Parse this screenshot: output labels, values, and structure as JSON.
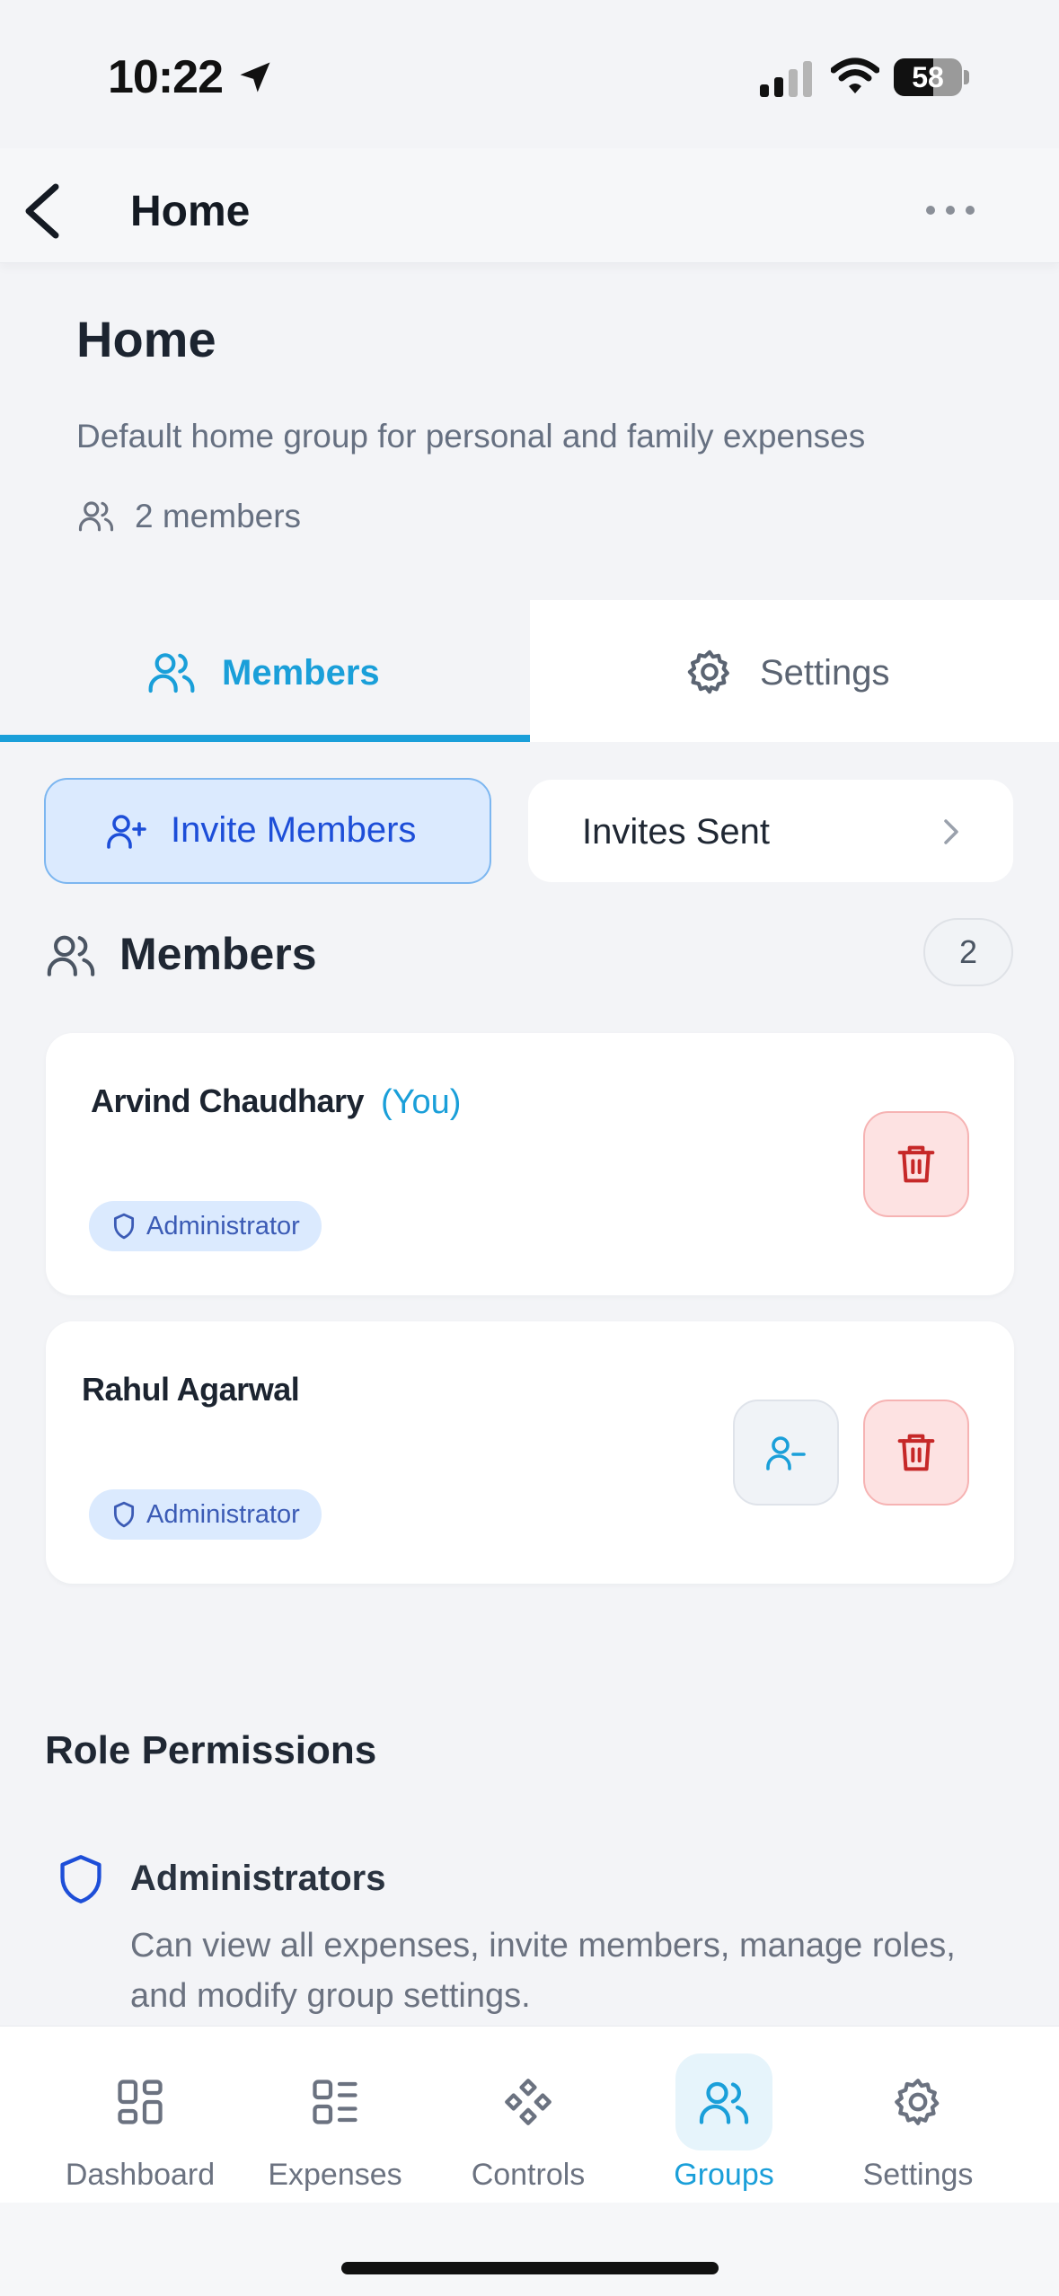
{
  "status_bar": {
    "time": "10:22",
    "battery": "58",
    "battery_level": 0.58
  },
  "nav": {
    "title": "Home"
  },
  "group": {
    "title": "Home",
    "description": "Default home group for personal and family expenses",
    "member_count_text": "2 members"
  },
  "tabs": [
    {
      "label": "Members",
      "icon": "users-icon",
      "active": true
    },
    {
      "label": "Settings",
      "icon": "gear-icon",
      "active": false
    }
  ],
  "actions": {
    "invite_label": "Invite Members",
    "invites_sent_label": "Invites Sent"
  },
  "members_section": {
    "heading": "Members",
    "count": "2",
    "members": [
      {
        "name": "Arvind Chaudhary",
        "you_tag": "(You)",
        "role": "Administrator"
      },
      {
        "name": "Rahul Agarwal",
        "role": "Administrator"
      }
    ]
  },
  "role_permissions": {
    "heading": "Role Permissions",
    "items": [
      {
        "role": "Administrators",
        "description": "Can view all expenses, invite members, manage roles, and modify group settings."
      }
    ]
  },
  "tabbar": {
    "items": [
      {
        "label": "Dashboard",
        "icon": "dashboard-icon"
      },
      {
        "label": "Expenses",
        "icon": "list-icon"
      },
      {
        "label": "Controls",
        "icon": "controls-icon"
      },
      {
        "label": "Groups",
        "icon": "users-icon",
        "active": true
      },
      {
        "label": "Settings",
        "icon": "gear-icon"
      }
    ]
  },
  "colors": {
    "accent": "#1a9fd9",
    "danger": "#c62828",
    "chip_bg": "#dbeafe"
  }
}
